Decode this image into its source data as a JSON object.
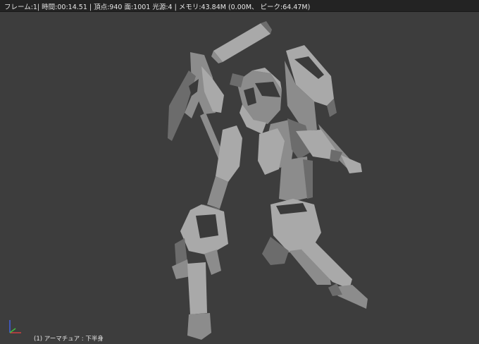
{
  "stats_header": {
    "text": "フレーム:1| 時間:00:14.51 | 頂点:940 面:1001 光源:4 | メモリ:43.84M (0.00M、 ピーク:64.47M)"
  },
  "viewport": {
    "background": "#3d3d3d",
    "model_color": "#8e8e8e"
  },
  "object_info": {
    "label": "(1) アーマチュア : 下半身"
  },
  "axis_gizmo": {
    "icon": "axis-gizmo-icon",
    "x_color": "#d04040",
    "y_color": "#40c040",
    "z_color": "#4060e0"
  }
}
